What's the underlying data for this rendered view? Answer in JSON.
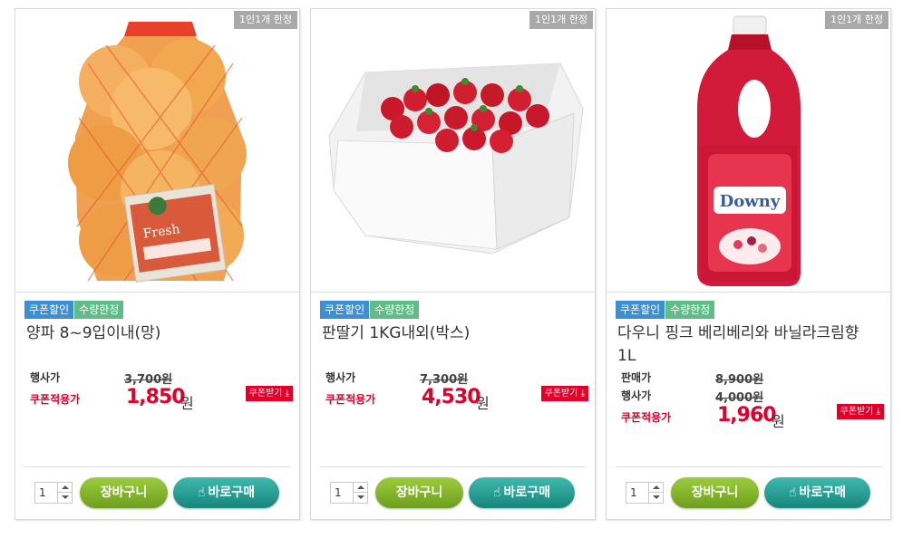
{
  "products": [
    {
      "limit_badge": "1인1개 한정",
      "tags": {
        "coupon": "쿠폰할인",
        "qty": "수량한정"
      },
      "name": "양파 8~9입이내(망)",
      "prices": [
        {
          "label": "행사가",
          "value": "3,700원"
        }
      ],
      "coupon_price": {
        "label": "쿠폰적용가",
        "amount": "1,850",
        "unit": "원"
      },
      "coupon_button": "쿠폰받기",
      "quantity": "1",
      "cart_button": "장바구니",
      "buy_button": "바로구매",
      "image_icon": "onion-bag-image"
    },
    {
      "limit_badge": "1인1개 한정",
      "tags": {
        "coupon": "쿠폰할인",
        "qty": "수량한정"
      },
      "name": "판딸기 1KG내외(박스)",
      "prices": [
        {
          "label": "행사가",
          "value": "7,300원"
        }
      ],
      "coupon_price": {
        "label": "쿠폰적용가",
        "amount": "4,530",
        "unit": "원"
      },
      "coupon_button": "쿠폰받기",
      "quantity": "1",
      "cart_button": "장바구니",
      "buy_button": "바로구매",
      "image_icon": "strawberry-box-image"
    },
    {
      "limit_badge": "1인1개 한정",
      "tags": {
        "coupon": "쿠폰할인",
        "qty": "수량한정"
      },
      "name": "다우니 핑크 베리베리와 바닐라크림향 1L",
      "prices": [
        {
          "label": "판매가",
          "value": "8,900원"
        },
        {
          "label": "행사가",
          "value": "4,000원"
        }
      ],
      "coupon_price": {
        "label": "쿠폰적용가",
        "amount": "1,960",
        "unit": "원"
      },
      "coupon_button": "쿠폰받기",
      "quantity": "1",
      "cart_button": "장바구니",
      "buy_button": "바로구매",
      "image_icon": "downy-bottle-image",
      "bottle_label": "Downy"
    }
  ],
  "colors": {
    "coupon_tag": "#3a8fd6",
    "qty_tag": "#5fbd87",
    "sale_red": "#e0002a",
    "cart_green": "#7fb12a",
    "buy_teal": "#23998f"
  }
}
